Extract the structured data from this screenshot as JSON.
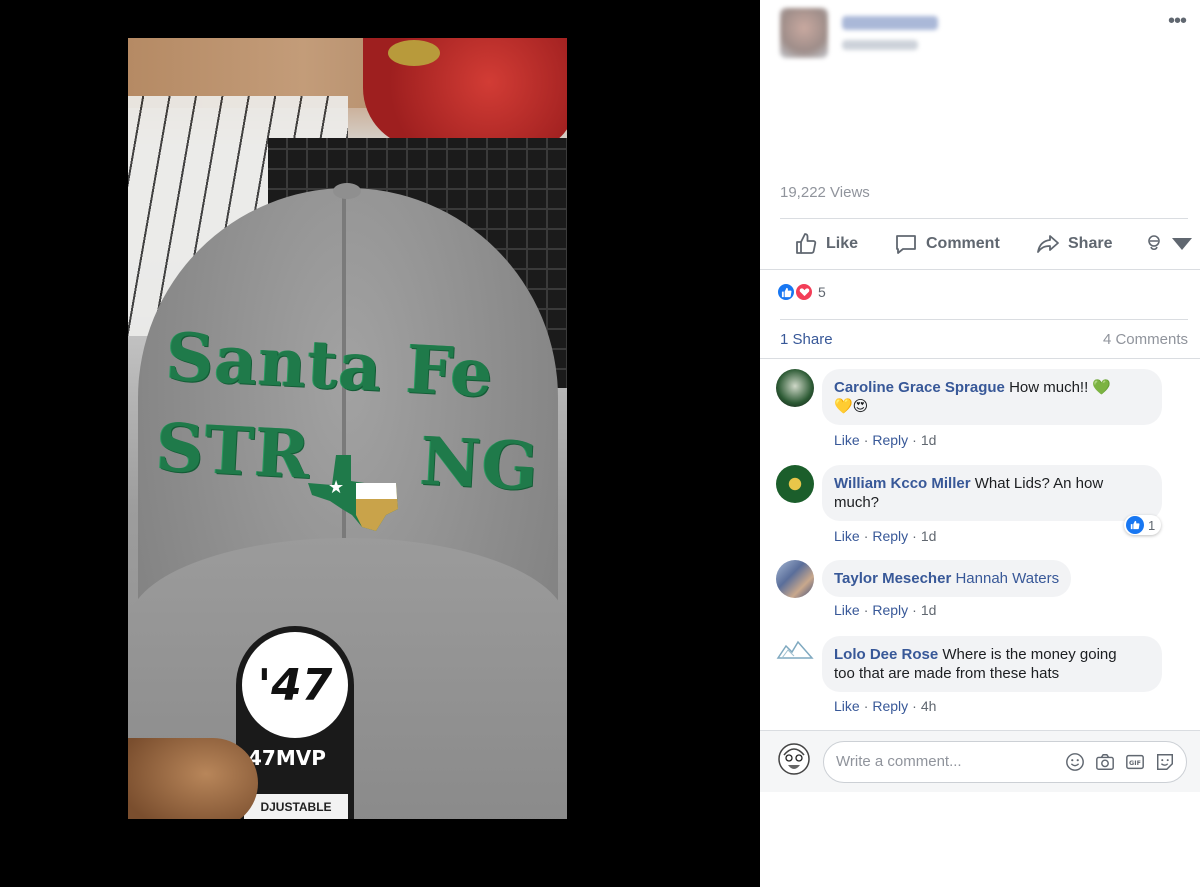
{
  "post": {
    "views": "19,222 Views",
    "more_label": "•••"
  },
  "actions": {
    "like": "Like",
    "comment": "Comment",
    "share": "Share"
  },
  "reactions": {
    "count": "5"
  },
  "stats": {
    "shares": "1 Share",
    "comments": "4 Comments"
  },
  "comments": [
    {
      "author": "Caroline Grace Sprague",
      "text": "How much!! 💚",
      "text2": "💛😍",
      "like": "Like",
      "reply": "Reply",
      "time": "1d"
    },
    {
      "author": "William Kcco Miller",
      "text": "What Lids? An how",
      "text2": "much?",
      "like": "Like",
      "reply": "Reply",
      "time": "1d",
      "reaction_count": "1"
    },
    {
      "author": "Taylor Mesecher",
      "text": "Hannah Waters",
      "like": "Like",
      "reply": "Reply",
      "time": "1d"
    },
    {
      "author": "Lolo Dee Rose",
      "text": "Where is the money going",
      "text2": "too that are made from these hats",
      "like": "Like",
      "reply": "Reply",
      "time": "4h"
    }
  ],
  "composer": {
    "placeholder": "Write a comment..."
  },
  "video": {
    "cap_line1": "Santa Fe",
    "cap_line2a": "STR",
    "cap_line2b": "NG",
    "tag_logo": "'47",
    "tag_model": "47MVP",
    "tag_adjust": "DJUSTABLE"
  },
  "colors": {
    "link_blue": "#385898",
    "muted": "#90949c",
    "like_blue": "#1877f2",
    "love_red": "#f33e58"
  }
}
